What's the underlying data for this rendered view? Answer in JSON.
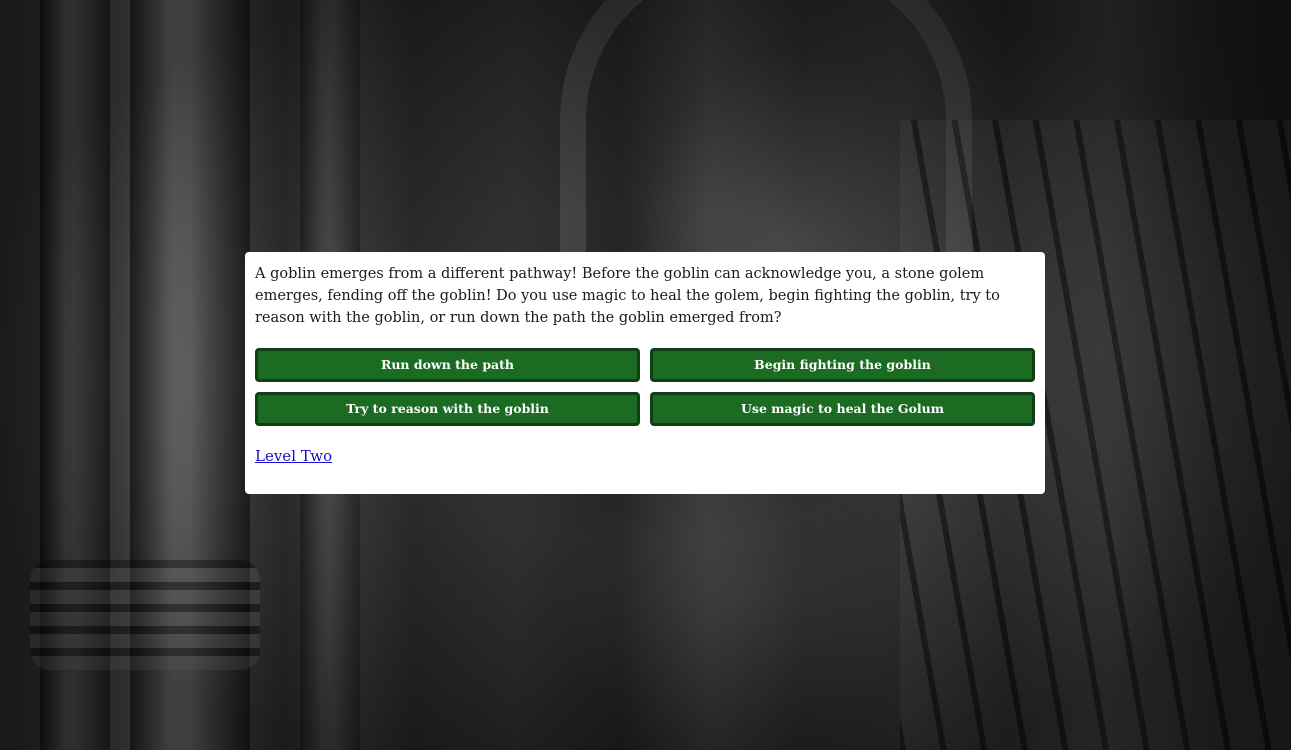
{
  "story": {
    "text": "A goblin emerges from a different pathway! Before the goblin can acknowledge you, a stone golem emerges, fending off the goblin! Do you use magic to heal the golem, begin fighting the goblin, try to reason with the goblin, or run down the path the goblin emerged from?"
  },
  "choices": {
    "run": "Run down the path",
    "fight": "Begin fighting the goblin",
    "reason": "Try to reason with the goblin",
    "heal": "Use magic to heal the Golum"
  },
  "link": {
    "label": "Level Two"
  },
  "colors": {
    "button_bg": "#1b6b22",
    "button_border": "#0f3f14",
    "link": "#1a0dcc",
    "card_bg": "#ffffff"
  }
}
